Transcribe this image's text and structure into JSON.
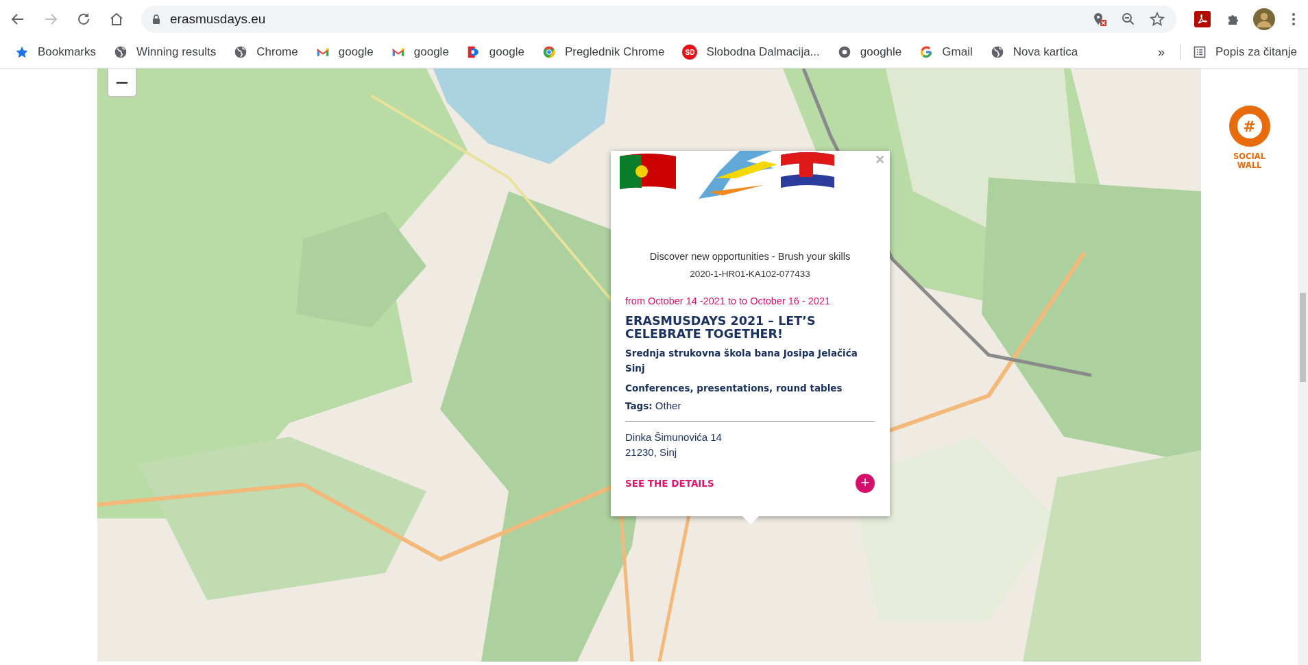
{
  "browser": {
    "url": "erasmusdays.eu",
    "forward_disabled": true,
    "bookmarks": [
      {
        "label": "Bookmarks",
        "kind": "star"
      },
      {
        "label": "Winning results",
        "kind": "globe"
      },
      {
        "label": "Chrome",
        "kind": "globe"
      },
      {
        "label": "google",
        "kind": "gmail"
      },
      {
        "label": "google",
        "kind": "gmail"
      },
      {
        "label": "google",
        "kind": "doc"
      },
      {
        "label": "Preglednik Chrome",
        "kind": "chrome"
      },
      {
        "label": "Slobodna Dalmacija...",
        "kind": "badge",
        "badge": "SD"
      },
      {
        "label": "googhle",
        "kind": "ring"
      },
      {
        "label": "Gmail",
        "kind": "google"
      },
      {
        "label": "Nova kartica",
        "kind": "globe"
      }
    ],
    "more": "»",
    "reading_list": "Popis za čitanje"
  },
  "map": {
    "kind": "picture",
    "zoom_out": "−"
  },
  "popup": {
    "subtitle": "Discover new opportunities - Brush your skills",
    "code": "2020-1-HR01-KA102-077433",
    "dates": "from October 14 -2021 to to October 16 - 2021",
    "title": "ERASMUSDAYS 2021 – LET’S CELEBRATE TOGETHER!",
    "organizer": "Srednja strukovna škola bana Josipa Jelačića Sinj",
    "activity": "Conferences, presentations, round tables",
    "tags_label": "Tags:",
    "tags": "Other",
    "address": [
      "Dinka Šimunovića 14",
      "21230, Sinj"
    ],
    "details": "SEE THE DETAILS",
    "close": "×",
    "plus": "+"
  },
  "social_wall": {
    "icon": "#",
    "label": [
      "SOCIAL",
      "WALL"
    ]
  }
}
